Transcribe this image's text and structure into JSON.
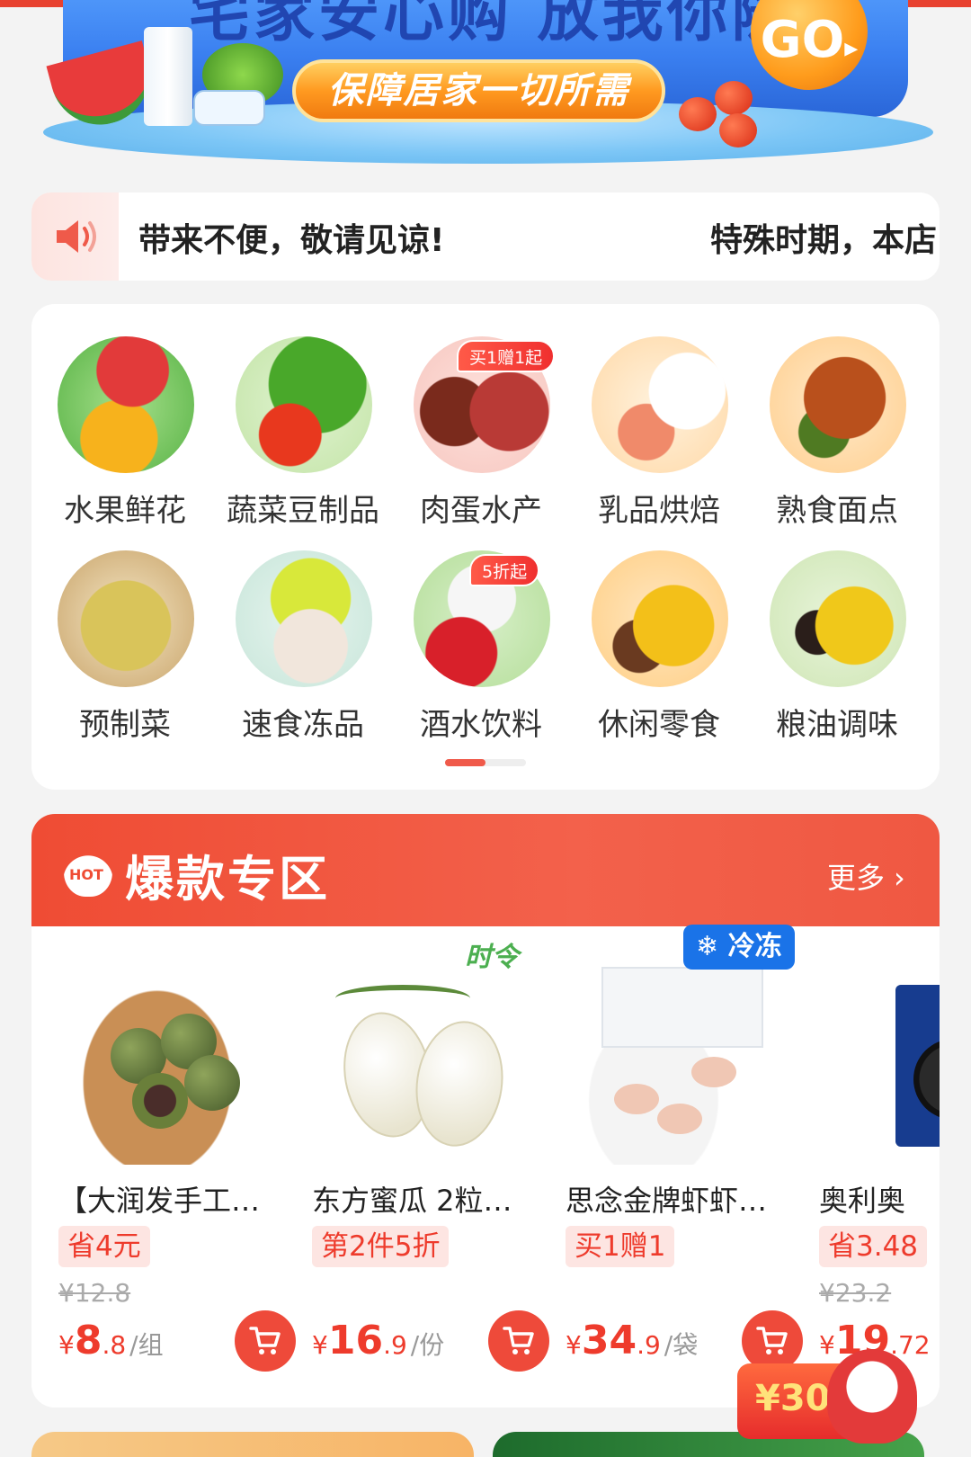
{
  "banner": {
    "title": "宅家安心购 放我你随便",
    "slogan": "保障居家一切所需",
    "go_label": "GO"
  },
  "notice": {
    "icon": "speaker-icon",
    "text_part1": "带来不便，敬请见谅!",
    "text_part2": "特殊时期，本店"
  },
  "categories": [
    {
      "label": "水果鲜花",
      "badge": ""
    },
    {
      "label": "蔬菜豆制品",
      "badge": ""
    },
    {
      "label": "肉蛋水产",
      "badge": "买1赠1起"
    },
    {
      "label": "乳品烘焙",
      "badge": ""
    },
    {
      "label": "熟食面点",
      "badge": ""
    },
    {
      "label": "预制菜",
      "badge": ""
    },
    {
      "label": "速食冻品",
      "badge": ""
    },
    {
      "label": "酒水饮料",
      "badge": "5折起"
    },
    {
      "label": "休闲零食",
      "badge": ""
    },
    {
      "label": "粮油调味",
      "badge": ""
    }
  ],
  "hot_zone": {
    "icon_text": "HOT",
    "title": "爆款专区",
    "more_label": "更多",
    "products": [
      {
        "name": "【大润发手工…",
        "promo": "省4元",
        "orig_price": "¥12.8",
        "price_int": "8",
        "price_dec": ".8",
        "unit": "/组",
        "tag": ""
      },
      {
        "name": "东方蜜瓜 2粒…",
        "promo": "第2件5折",
        "orig_price": "",
        "price_int": "16",
        "price_dec": ".9",
        "unit": "/份",
        "tag": "时令"
      },
      {
        "name": "思念金牌虾虾…",
        "promo": "买1赠1",
        "orig_price": "",
        "price_int": "34",
        "price_dec": ".9",
        "unit": "/袋",
        "tag": "冷冻"
      },
      {
        "name": "奥利奥",
        "promo": "省3.48",
        "orig_price": "¥23.2",
        "price_int": "19",
        "price_dec": ".72",
        "unit": "",
        "tag": ""
      }
    ],
    "currency": "¥"
  },
  "float_coupon": {
    "amount": "¥30"
  },
  "colors": {
    "accent": "#ee3b2c",
    "header_red": "#ef4c34",
    "cold_blue": "#1a73e8",
    "seasonal_green": "#4caf50"
  }
}
